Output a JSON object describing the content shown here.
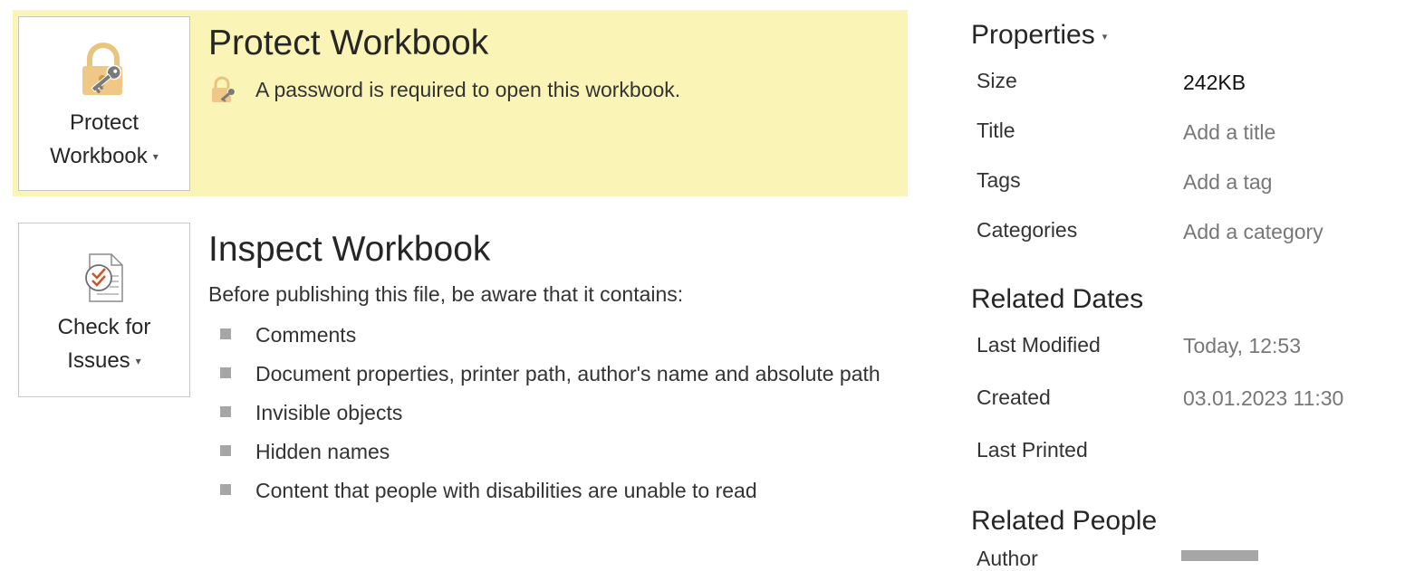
{
  "protect": {
    "button_line1": "Protect",
    "button_line2": "Workbook",
    "title": "Protect Workbook",
    "status": "A password is required to open this workbook.",
    "highlight_color": "#fbf4b7",
    "icon": "lock-key-icon"
  },
  "inspect": {
    "button_line1": "Check for",
    "button_line2": "Issues",
    "title": "Inspect Workbook",
    "intro": "Before publishing this file, be aware that it contains:",
    "icon": "document-check-icon",
    "items": [
      "Comments",
      "Document properties, printer path, author's name and absolute path",
      "Invisible objects",
      "Hidden names",
      "Content that people with disabilities are unable to read"
    ]
  },
  "properties": {
    "heading": "Properties",
    "size_label": "Size",
    "size_value": "242KB",
    "title_label": "Title",
    "title_placeholder": "Add a title",
    "tags_label": "Tags",
    "tags_placeholder": "Add a tag",
    "categories_label": "Categories",
    "categories_placeholder": "Add a category"
  },
  "related_dates": {
    "heading": "Related Dates",
    "last_modified_label": "Last Modified",
    "last_modified_value": "Today, 12:53",
    "created_label": "Created",
    "created_value": "03.01.2023 11:30",
    "last_printed_label": "Last Printed"
  },
  "related_people": {
    "heading": "Related People",
    "author_label": "Author"
  }
}
